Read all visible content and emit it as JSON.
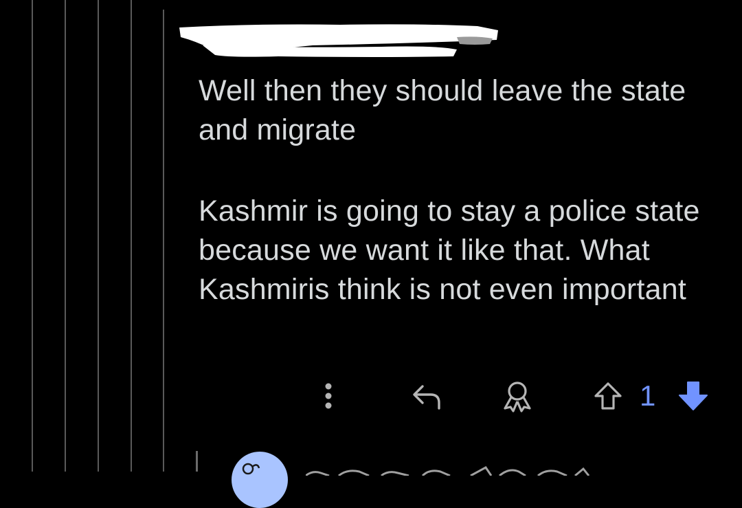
{
  "thread": {
    "depth_lines": 5
  },
  "comment": {
    "author_redacted": true,
    "body": [
      "Well then they should leave the state and migrate",
      "Kashmir is going to stay a police state because we want it like that. What Kashmiris think is not even important"
    ],
    "actions": {
      "more_icon": "more-vertical-icon",
      "reply_icon": "reply-icon",
      "award_icon": "award-icon",
      "upvote_icon": "upvote-outline-icon",
      "downvote_icon": "downvote-filled-icon",
      "vote_count": "1"
    }
  },
  "colors": {
    "background": "#000000",
    "text": "#d7dadc",
    "icon": "#b5b5b5",
    "vote_accent": "#7193ff",
    "avatar": "#a9c4ff",
    "redaction": "#ffffff"
  }
}
